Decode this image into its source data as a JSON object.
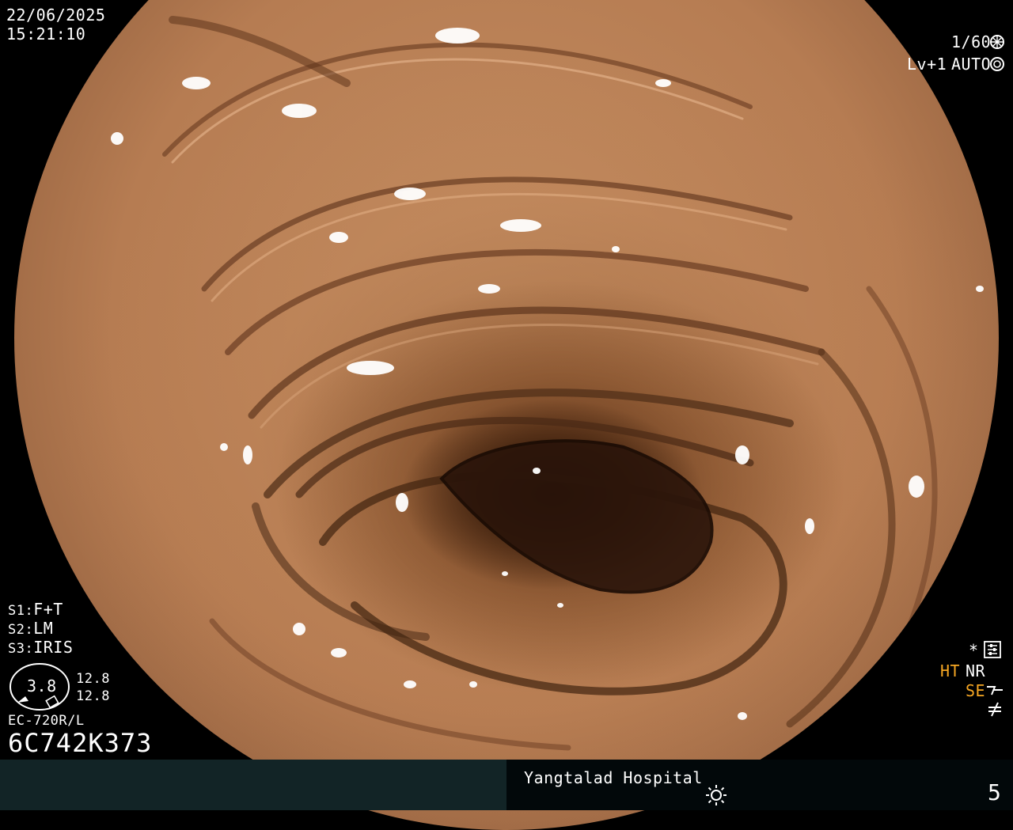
{
  "header": {
    "date": "22/06/2025",
    "time": "15:21:10"
  },
  "top_right": {
    "shutter": "1/60",
    "level": "Lv+1",
    "mode": "AUTO"
  },
  "settings": {
    "s1_label": "S1:",
    "s1_value": "F+T",
    "s2_label": "S2:",
    "s2_value": "LM",
    "s3_label": "S3:",
    "s3_value": "IRIS"
  },
  "gauge": {
    "value": "3.8",
    "upper": "12.8",
    "lower": "12.8"
  },
  "scope": {
    "model": "EC-720R/L",
    "serial": "6C742K373"
  },
  "right_indicators": {
    "star": "*",
    "ht": "HT",
    "nr": "NR",
    "se": "SE"
  },
  "footer": {
    "hospital": "Yangtalad Hospital",
    "number": "5"
  },
  "icons": {
    "shutter": "aperture-icon",
    "auto": "auto-iris-icon",
    "settings": "settings-panel-icon",
    "se": "structure-enhance-icon",
    "slash": "not-equal-icon",
    "light": "sun-icon"
  },
  "colors": {
    "accent_amber": "#f5a623",
    "bar_dark_teal": "#122426",
    "bar_black": "#02080a"
  }
}
